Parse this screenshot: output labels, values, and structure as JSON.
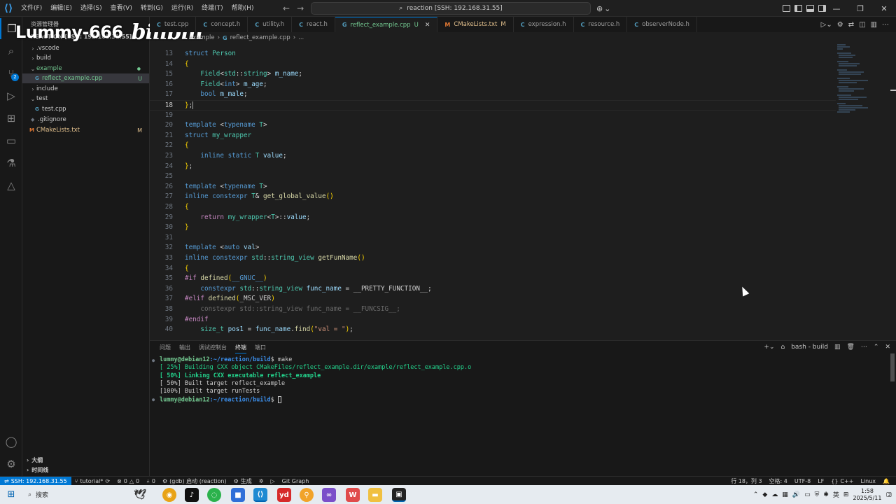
{
  "titlebar": {
    "menus": [
      "文件(F)",
      "编辑(E)",
      "选择(S)",
      "查看(V)",
      "转到(G)",
      "运行(R)",
      "终端(T)",
      "帮助(H)"
    ],
    "search": "reaction [SSH: 192.168.31.55]"
  },
  "watermark": {
    "user": "Lummy-666",
    "logo": "bilibili"
  },
  "sidebar": {
    "title": "资源管理器",
    "workspace": "REACTION [SSH: 192.168.31.55]",
    "items": [
      {
        "name": ".vscode",
        "status": ""
      },
      {
        "name": "build",
        "status": ""
      },
      {
        "name": "example",
        "status": ""
      },
      {
        "name": "reflect_example.cpp",
        "status": "U"
      },
      {
        "name": "include",
        "status": ""
      },
      {
        "name": "test",
        "status": ""
      },
      {
        "name": "test.cpp",
        "status": ""
      },
      {
        "name": ".gitignore",
        "status": ""
      },
      {
        "name": "CMakeLists.txt",
        "status": "M"
      }
    ],
    "outline": "大纲",
    "timeline": "时间线"
  },
  "tabs": [
    {
      "label": "test.cpp",
      "icon": "C",
      "state": ""
    },
    {
      "label": "concept.h",
      "icon": "C",
      "state": ""
    },
    {
      "label": "utility.h",
      "icon": "C",
      "state": ""
    },
    {
      "label": "react.h",
      "icon": "C",
      "state": ""
    },
    {
      "label": "reflect_example.cpp",
      "icon": "G",
      "state": "U"
    },
    {
      "label": "CMakeLists.txt",
      "icon": "M",
      "state": "M"
    },
    {
      "label": "expression.h",
      "icon": "C",
      "state": ""
    },
    {
      "label": "resource.h",
      "icon": "C",
      "state": ""
    },
    {
      "label": "observerNode.h",
      "icon": "C",
      "state": ""
    }
  ],
  "breadcrumb": {
    "folder": "example",
    "file": "reflect_example.cpp",
    "more": "..."
  },
  "code": {
    "line_numbers": [
      "13",
      "14",
      "15",
      "16",
      "17",
      "18",
      "19",
      "20",
      "21",
      "22",
      "23",
      "24",
      "25",
      "26",
      "27",
      "28",
      "29",
      "30",
      "31",
      "32",
      "33",
      "34",
      "35",
      "36",
      "37",
      "38",
      "39",
      "40"
    ],
    "current_line": "18"
  },
  "panel": {
    "tabs": [
      "问题",
      "输出",
      "调试控制台",
      "终端",
      "端口"
    ],
    "active_tab": "终端",
    "shell": "bash - build",
    "terminal": {
      "prompt_user": "lummy@debian12",
      "prompt_path": ":~/reaction/build",
      "command": "make",
      "lines": [
        "[ 25%] Building CXX object CMakeFiles/reflect_example.dir/example/reflect_example.cpp.o",
        "[ 50%] Linking CXX executable reflect_example",
        "[ 50%] Built target reflect_example",
        "[100%] Built target runTests"
      ]
    }
  },
  "statusbar": {
    "remote": "SSH: 192.168.31.55",
    "branch": "tutorial*",
    "errors": "0",
    "warnings": "0",
    "ports": "0",
    "debug": "(gdb) 启动 (reaction)",
    "build": "生成",
    "git_graph": "Git Graph",
    "position": "行 18，列 3",
    "spaces": "空格: 4",
    "encoding": "UTF-8",
    "eol": "LF",
    "language": "C++",
    "platform": "Linux"
  },
  "taskbar": {
    "search": "搜索",
    "time": "1:58",
    "date": "2025/5/11",
    "ime": "英",
    "notifications": "2"
  },
  "colors": {
    "accent": "#0078d4",
    "untracked": "#73c991",
    "modified": "#e2c08d"
  }
}
